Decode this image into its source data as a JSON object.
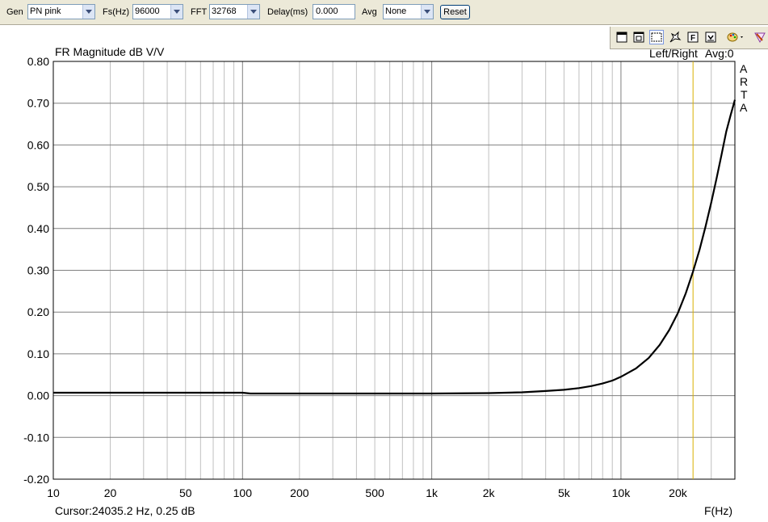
{
  "toolbar": {
    "gen_label": "Gen",
    "gen_value": "PN pink",
    "fs_label": "Fs(Hz)",
    "fs_value": "96000",
    "fft_label": "FFT",
    "fft_value": "32768",
    "delay_label": "Delay(ms)",
    "delay_value": "0.000",
    "avg_label": "Avg",
    "avg_value": "None",
    "reset_label": "Reset"
  },
  "icon_bar": {
    "icons": [
      "window-icon",
      "tile-window-icon",
      "select-region-icon",
      "marker-icon",
      "f-button-icon",
      "save-graph-icon",
      "palette-icon",
      "brush-icon"
    ]
  },
  "plot": {
    "title": "FR Magnitude dB V/V",
    "channel_info": "Left/Right",
    "avg_info": "Avg:0",
    "brand_letters": [
      "A",
      "R",
      "T",
      "A"
    ],
    "cursor_readout": "Cursor:24035.2 Hz, 0.25 dB",
    "x_unit_label": "F(Hz)"
  },
  "chart_data": {
    "type": "line",
    "title": "FR Magnitude dB V/V",
    "xlabel": "F(Hz)",
    "ylabel": "",
    "xscale": "log",
    "xlim": [
      10,
      40000
    ],
    "ylim": [
      -0.2,
      0.8
    ],
    "grid": true,
    "x_tick_labels": [
      "10",
      "20",
      "50",
      "100",
      "200",
      "500",
      "1k",
      "2k",
      "5k",
      "10k",
      "20k"
    ],
    "x_tick_values": [
      10,
      20,
      50,
      100,
      200,
      500,
      1000,
      2000,
      5000,
      10000,
      20000
    ],
    "y_tick_labels": [
      "0.80",
      "0.70",
      "0.60",
      "0.50",
      "0.40",
      "0.30",
      "0.20",
      "0.10",
      "0.00",
      "-0.10",
      "-0.20"
    ],
    "y_tick_values": [
      0.8,
      0.7,
      0.6,
      0.5,
      0.4,
      0.3,
      0.2,
      0.1,
      0.0,
      -0.1,
      -0.2
    ],
    "cursor": {
      "x": 24035.2,
      "y": 0.25,
      "color": "#d8b000"
    },
    "series": [
      {
        "color": "#000000",
        "x": [
          10,
          20,
          50,
          100,
          110,
          200,
          500,
          1000,
          2000,
          3000,
          4000,
          5000,
          6000,
          7000,
          8000,
          9000,
          10000,
          12000,
          14000,
          16000,
          18000,
          20000,
          22000,
          24000,
          26000,
          28000,
          30000,
          32000,
          34000,
          36000,
          38000,
          40000
        ],
        "y": [
          0.007,
          0.007,
          0.007,
          0.007,
          0.005,
          0.005,
          0.005,
          0.005,
          0.006,
          0.008,
          0.011,
          0.014,
          0.018,
          0.023,
          0.029,
          0.036,
          0.045,
          0.065,
          0.09,
          0.121,
          0.157,
          0.198,
          0.245,
          0.296,
          0.349,
          0.405,
          0.462,
          0.52,
          0.577,
          0.632,
          0.672,
          0.708
        ]
      }
    ]
  }
}
